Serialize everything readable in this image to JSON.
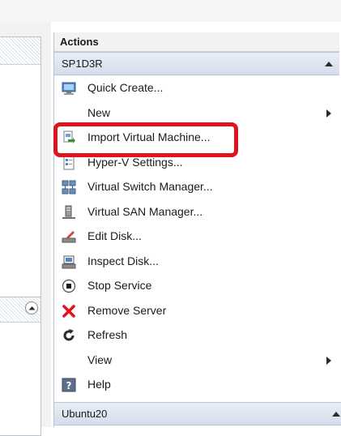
{
  "actions": {
    "title": "Actions",
    "server": {
      "name": "SP1D3R",
      "items": [
        {
          "label": "Quick Create...",
          "icon": "monitor-icon"
        },
        {
          "label": "New",
          "icon": "none",
          "submenu": true
        },
        {
          "label": "Import Virtual Machine...",
          "icon": "import-vm-icon",
          "highlighted": true
        },
        {
          "label": "Hyper-V Settings...",
          "icon": "settings-page-icon"
        },
        {
          "label": "Virtual Switch Manager...",
          "icon": "network-switch-icon"
        },
        {
          "label": "Virtual SAN Manager...",
          "icon": "san-icon"
        },
        {
          "label": "Edit Disk...",
          "icon": "edit-disk-icon"
        },
        {
          "label": "Inspect Disk...",
          "icon": "inspect-disk-icon"
        },
        {
          "label": "Stop Service",
          "icon": "stop-service-icon"
        },
        {
          "label": "Remove Server",
          "icon": "remove-x-icon"
        },
        {
          "label": "Refresh",
          "icon": "refresh-icon"
        },
        {
          "label": "View",
          "icon": "none",
          "submenu": true
        },
        {
          "label": "Help",
          "icon": "help-icon"
        }
      ]
    },
    "vm": {
      "name": "Ubuntu20"
    }
  },
  "colors": {
    "highlight": "#e0141d",
    "header_gradient_top": "#e8eef6",
    "header_gradient_bottom": "#d4deea",
    "remove_red": "#e3101a"
  }
}
